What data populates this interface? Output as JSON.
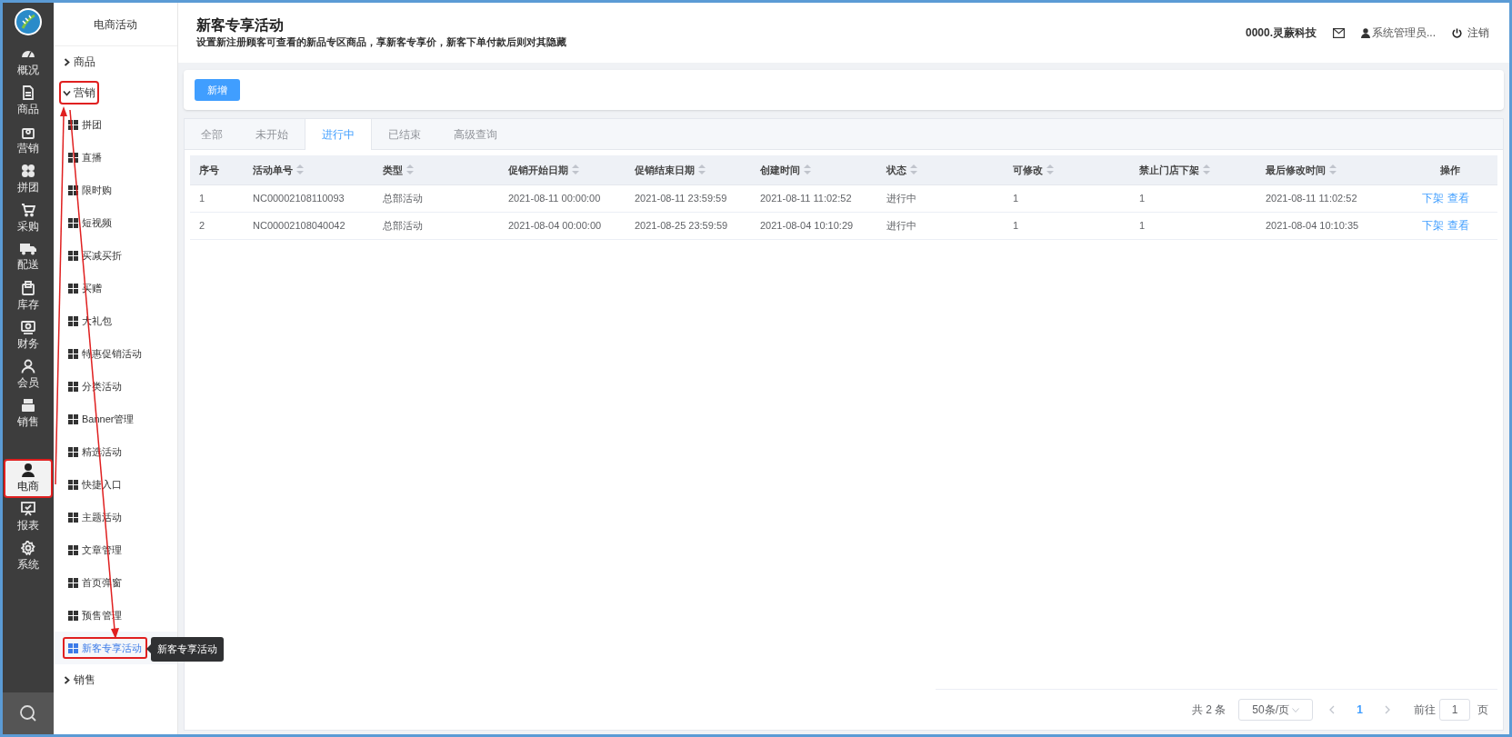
{
  "rail": {
    "items": [
      {
        "label": "概况",
        "selected": false,
        "annotated": false
      },
      {
        "label": "商品",
        "selected": false,
        "annotated": false
      },
      {
        "label": "营销",
        "selected": false,
        "annotated": false
      },
      {
        "label": "拼团",
        "selected": false,
        "annotated": false
      },
      {
        "label": "采购",
        "selected": false,
        "annotated": false
      },
      {
        "label": "配送",
        "selected": false,
        "annotated": false
      },
      {
        "label": "库存",
        "selected": false,
        "annotated": false
      },
      {
        "label": "财务",
        "selected": false,
        "annotated": false
      },
      {
        "label": "会员",
        "selected": false,
        "annotated": false
      },
      {
        "label": "销售",
        "selected": false,
        "annotated": false
      },
      {
        "label": "电商",
        "selected": true,
        "annotated": true
      },
      {
        "label": "报表",
        "selected": false,
        "annotated": false
      },
      {
        "label": "系统",
        "selected": false,
        "annotated": false
      }
    ]
  },
  "sidebar": {
    "title": "电商活动",
    "groups": [
      {
        "label": "商品",
        "expanded": false,
        "annotated": false
      },
      {
        "label": "营销",
        "expanded": true,
        "annotated": true,
        "children": [
          {
            "label": "拼团",
            "selected": false,
            "annotated": false
          },
          {
            "label": "直播",
            "selected": false,
            "annotated": false
          },
          {
            "label": "限时购",
            "selected": false,
            "annotated": false
          },
          {
            "label": "短视频",
            "selected": false,
            "annotated": false
          },
          {
            "label": "买减买折",
            "selected": false,
            "annotated": false
          },
          {
            "label": "买赠",
            "selected": false,
            "annotated": false
          },
          {
            "label": "大礼包",
            "selected": false,
            "annotated": false
          },
          {
            "label": "特惠促销活动",
            "selected": false,
            "annotated": false
          },
          {
            "label": "分类活动",
            "selected": false,
            "annotated": false
          },
          {
            "label": "Banner管理",
            "selected": false,
            "annotated": false
          },
          {
            "label": "精选活动",
            "selected": false,
            "annotated": false
          },
          {
            "label": "快捷入口",
            "selected": false,
            "annotated": false
          },
          {
            "label": "主题活动",
            "selected": false,
            "annotated": false
          },
          {
            "label": "文章管理",
            "selected": false,
            "annotated": false
          },
          {
            "label": "首页弹窗",
            "selected": false,
            "annotated": false
          },
          {
            "label": "预售管理",
            "selected": false,
            "annotated": false
          },
          {
            "label": "新客专享活动",
            "selected": true,
            "annotated": true,
            "tooltip": "新客专享活动"
          }
        ]
      },
      {
        "label": "销售",
        "expanded": false,
        "annotated": false
      }
    ]
  },
  "header": {
    "title": "新客专享活动",
    "subtitle": "设置新注册顾客可查看的新品专区商品，享新客专享价，新客下单付款后则对其隐藏",
    "company": "0000.灵蕨科技",
    "user": "系统管理员...",
    "logout": "注销"
  },
  "toolbar": {
    "buttons": [
      "新增"
    ]
  },
  "tabs": [
    {
      "label": "全部",
      "selected": false
    },
    {
      "label": "未开始",
      "selected": false
    },
    {
      "label": "进行中",
      "selected": true
    },
    {
      "label": "已结束",
      "selected": false
    },
    {
      "label": "高级查询",
      "selected": false
    }
  ],
  "table": {
    "columns": [
      {
        "label": "序号",
        "sortable": false
      },
      {
        "label": "活动单号",
        "sortable": true
      },
      {
        "label": "类型",
        "sortable": true
      },
      {
        "label": "促销开始日期",
        "sortable": true
      },
      {
        "label": "促销结束日期",
        "sortable": true
      },
      {
        "label": "创建时间",
        "sortable": true
      },
      {
        "label": "状态",
        "sortable": true
      },
      {
        "label": "可修改",
        "sortable": true
      },
      {
        "label": "禁止门店下架",
        "sortable": true
      },
      {
        "label": "最后修改时间",
        "sortable": true
      },
      {
        "label": "操作",
        "sortable": false
      }
    ],
    "rows": [
      {
        "cells": [
          "1",
          "NC00002108110093",
          "总部活动",
          "2021-08-11 00:00:00",
          "2021-08-11 23:59:59",
          "2021-08-11 11:02:52",
          "进行中",
          "1",
          "1",
          "2021-08-11 11:02:52"
        ],
        "actions": [
          "下架",
          "查看"
        ]
      },
      {
        "cells": [
          "2",
          "NC00002108040042",
          "总部活动",
          "2021-08-04 00:00:00",
          "2021-08-25 23:59:59",
          "2021-08-04 10:10:29",
          "进行中",
          "1",
          "1",
          "2021-08-04 10:10:35"
        ],
        "actions": [
          "下架",
          "查看"
        ]
      }
    ]
  },
  "pagination": {
    "total": "共 2 条",
    "page_size": "50条/页",
    "pages": [
      {
        "label": "1",
        "selected": true
      }
    ],
    "goto_label": "前往",
    "goto_value": "1",
    "goto_suffix": "页"
  }
}
